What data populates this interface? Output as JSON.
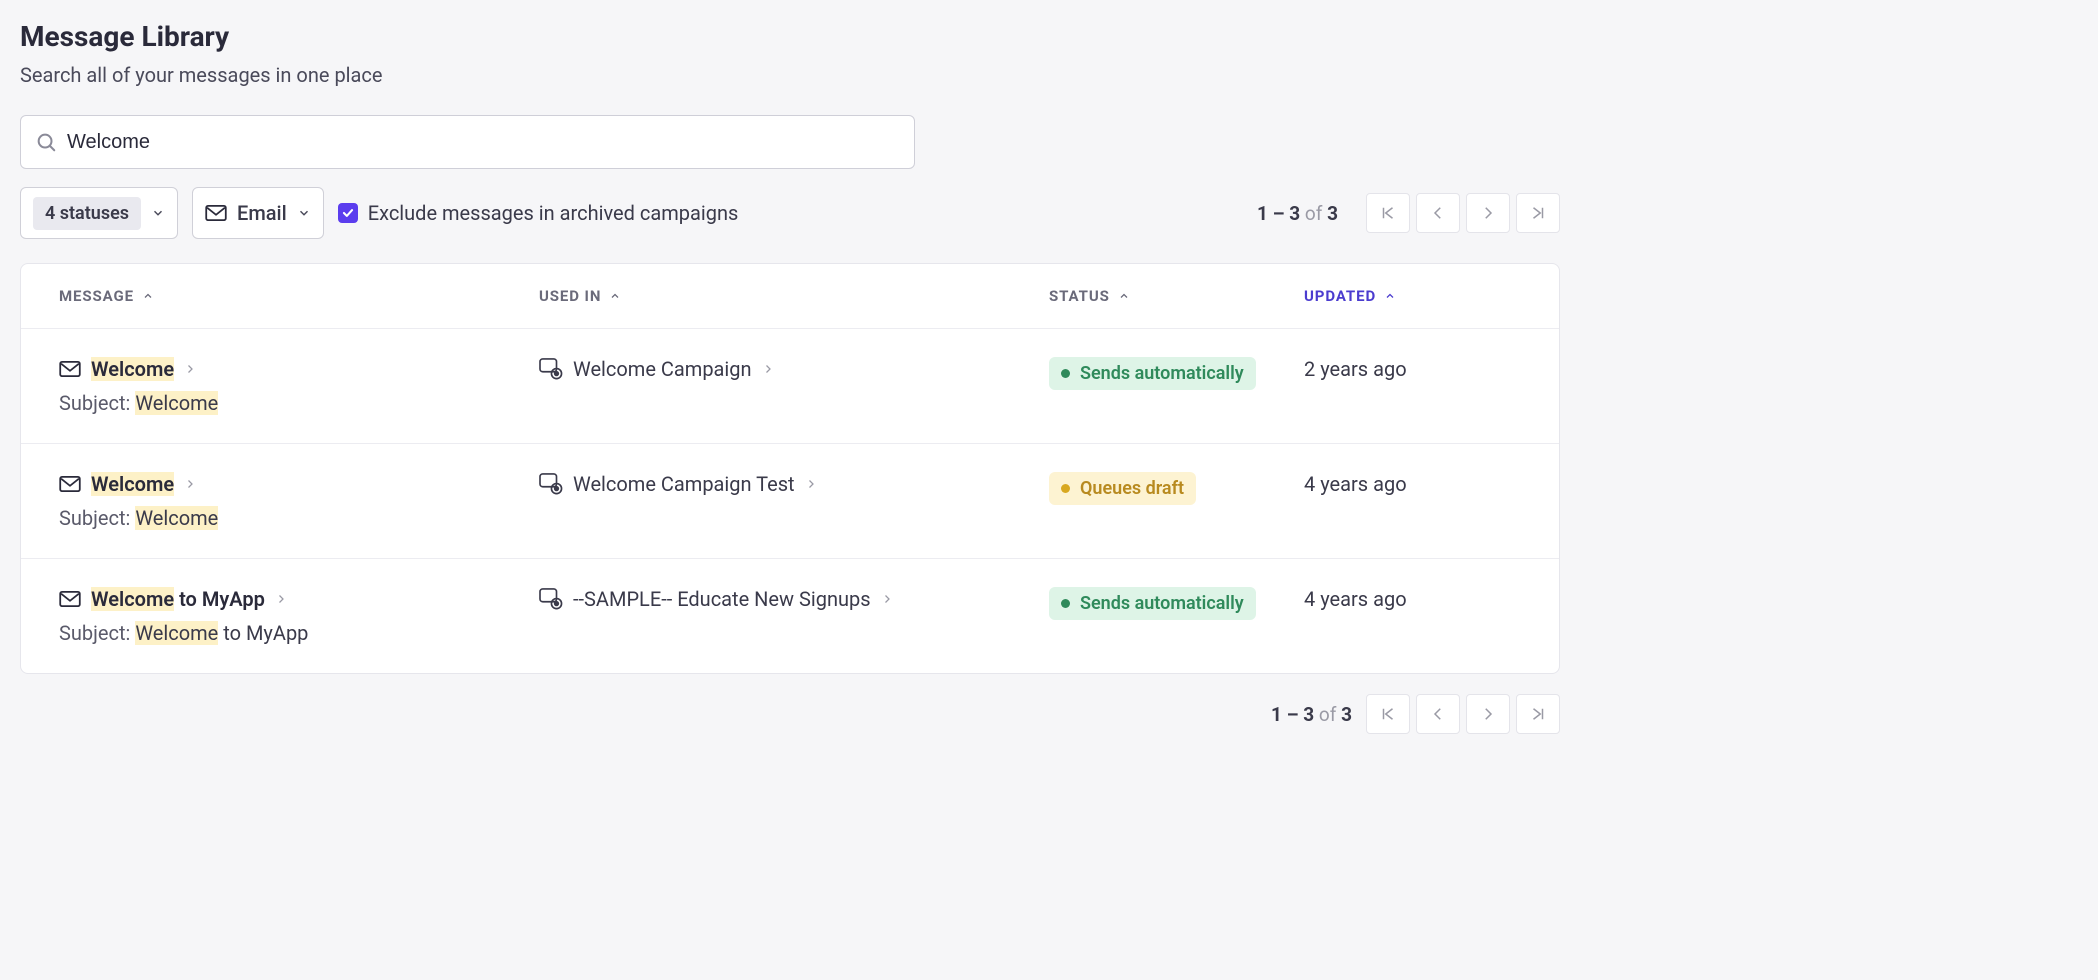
{
  "header": {
    "title": "Message Library",
    "subtitle": "Search all of your messages in one place"
  },
  "search": {
    "value": "Welcome",
    "placeholder": ""
  },
  "filters": {
    "statuses_label": "4 statuses",
    "channel_label": "Email",
    "exclude_archived_label": "Exclude messages in archived campaigns",
    "exclude_archived_checked": true
  },
  "pagination": {
    "range": "1 – 3",
    "of_label": "of",
    "total": "3"
  },
  "columns": {
    "message": "MESSAGE",
    "used_in": "USED IN",
    "status": "STATUS",
    "updated": "UPDATED"
  },
  "subject_label": "Subject:",
  "rows": [
    {
      "title_hl": "Welcome",
      "title_rest": "",
      "subject_hl": "Welcome",
      "subject_rest": "",
      "used_in": "Welcome Campaign",
      "status_text": "Sends automatically",
      "status_kind": "green",
      "updated": "2 years ago"
    },
    {
      "title_hl": "Welcome",
      "title_rest": "",
      "subject_hl": "Welcome",
      "subject_rest": "",
      "used_in": "Welcome Campaign Test",
      "status_text": "Queues draft",
      "status_kind": "yellow",
      "updated": "4 years ago"
    },
    {
      "title_hl": "Welcome",
      "title_rest": " to MyApp",
      "subject_hl": "Welcome",
      "subject_rest": " to MyApp",
      "used_in": "--SAMPLE-- Educate New Signups",
      "status_text": "Sends automatically",
      "status_kind": "green",
      "updated": "4 years ago"
    }
  ]
}
